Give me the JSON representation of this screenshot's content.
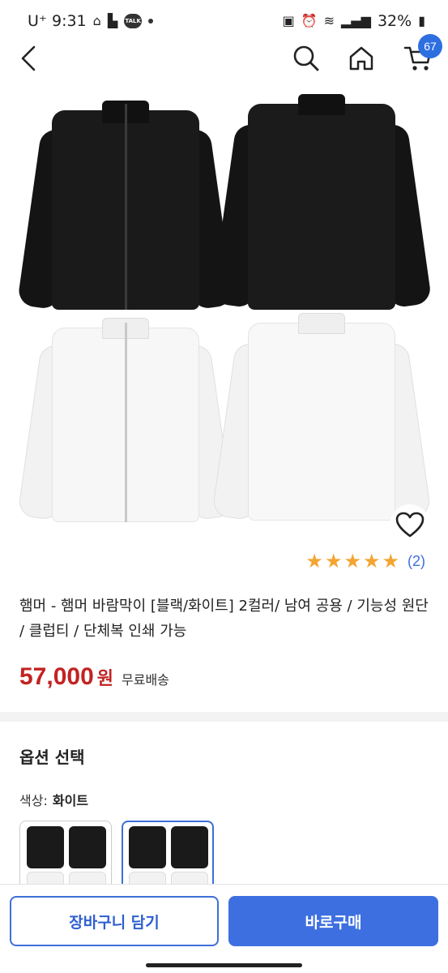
{
  "status_bar": {
    "carrier_time": "U⁺ 9:31",
    "battery": "32%",
    "talk_label": "TALK"
  },
  "header": {
    "icons": [
      "back-icon",
      "search-icon",
      "home-icon",
      "cart-icon"
    ],
    "cart_count": "67"
  },
  "product": {
    "rating_stars": 5,
    "review_count": "(2)",
    "title": "햄머 - 햄머 바람막이 [블랙/화이트] 2컬러/ 남여 공용 / 기능성 원단 / 클럽티 / 단체복 인쇄 가능",
    "price": "57,000",
    "price_unit": "원",
    "shipping": "무료배송"
  },
  "options": {
    "title": "옵션 선택",
    "color_label": "색상:",
    "color_value": "화이트",
    "selected_index": 1
  },
  "actions": {
    "add_to_cart": "장바구니 담기",
    "buy_now": "바로구매"
  },
  "colors": {
    "accent": "#3d6fe0",
    "price": "#c32222",
    "star": "#f3a532",
    "badge": "#2e6fe0"
  }
}
